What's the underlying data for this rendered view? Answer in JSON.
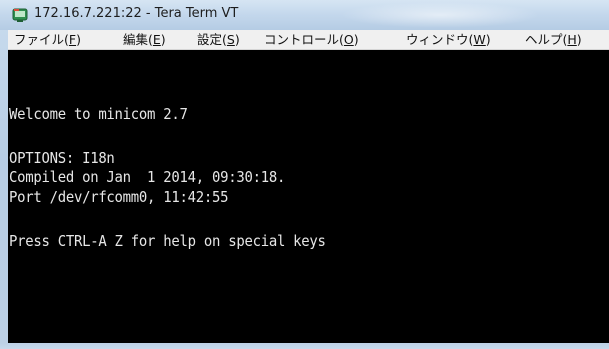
{
  "window": {
    "title": "172.16.7.221:22 - Tera Term VT",
    "icon": "tera-term-app-icon"
  },
  "menubar": {
    "items": [
      {
        "label": "ファイル(",
        "accel": "F",
        "tail": ")"
      },
      {
        "label": "編集(",
        "accel": "E",
        "tail": ")"
      },
      {
        "label": "設定(",
        "accel": "S",
        "tail": ")"
      },
      {
        "label": "コントロール(",
        "accel": "O",
        "tail": ")"
      },
      {
        "label": "ウィンドウ(",
        "accel": "W",
        "tail": ")"
      },
      {
        "label": "ヘルプ(",
        "accel": "H",
        "tail": ")"
      }
    ]
  },
  "terminal": {
    "lines": [
      "Welcome to minicom 2.7",
      "",
      "OPTIONS: I18n",
      "Compiled on Jan  1 2014, 09:30:18.",
      "Port /dev/rfcomm0, 11:42:55",
      "",
      "Press CTRL-A Z for help on special keys"
    ]
  },
  "colors": {
    "terminal_bg": "#000000",
    "terminal_fg": "#e6e6e6",
    "menubar_bg": "#f0f0f0",
    "titlebar": "#c3d7ec"
  }
}
